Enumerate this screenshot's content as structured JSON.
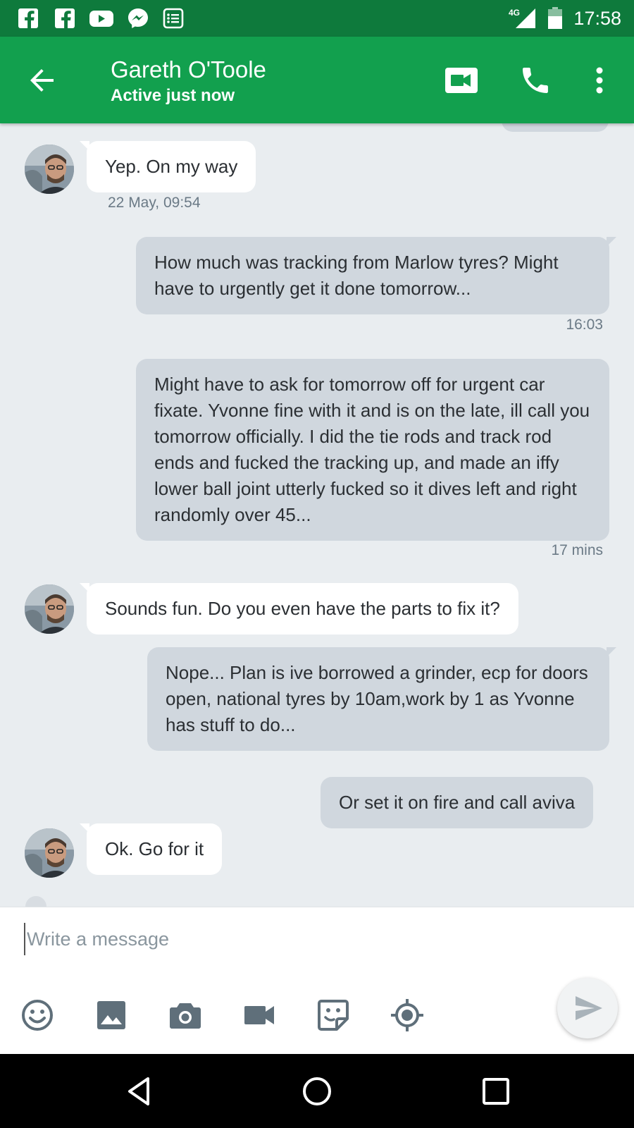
{
  "status_bar": {
    "network": "4G",
    "time": "17:58",
    "notification_icons": [
      "facebook-icon",
      "facebook-icon",
      "youtube-icon",
      "messenger-icon",
      "news-icon"
    ]
  },
  "app_bar": {
    "contact_name": "Gareth O'Toole",
    "contact_status": "Active just now"
  },
  "messages": [
    {
      "direction": "in",
      "text": "Yep. On my way",
      "time": "22 May, 09:54"
    },
    {
      "direction": "out",
      "text": "How much was tracking from Marlow tyres? Might have to urgently get it done tomorrow...",
      "time": "16:03"
    },
    {
      "direction": "out",
      "text": "Might have to ask for tomorrow off for urgent car fixate. Yvonne fine with it and is on the late, ill call you tomorrow officially. I did the tie rods and track rod ends and fucked the tracking up, and made an iffy lower ball joint utterly fucked so it dives left and right randomly over 45...",
      "time": "17 mins"
    },
    {
      "direction": "in",
      "text": "Sounds fun. Do you even have the parts to fix it?"
    },
    {
      "direction": "out",
      "text": "Nope... Plan is ive borrowed a grinder, ecp for doors open, national tyres by 10am,work by 1 as Yvonne has stuff to do..."
    },
    {
      "direction": "out",
      "text": "Or set it on fire and call aviva"
    },
    {
      "direction": "in",
      "text": "Ok. Go for it"
    }
  ],
  "composer": {
    "placeholder": "Write a message",
    "tools": [
      "emoji-icon",
      "gallery-icon",
      "camera-icon",
      "video-icon",
      "sticker-icon",
      "location-icon"
    ]
  },
  "colors": {
    "status_bar": "#0e7a3c",
    "app_bar": "#12a04e",
    "background": "#e9edf0",
    "outgoing_bubble": "#d0d7de",
    "incoming_bubble": "#ffffff"
  }
}
